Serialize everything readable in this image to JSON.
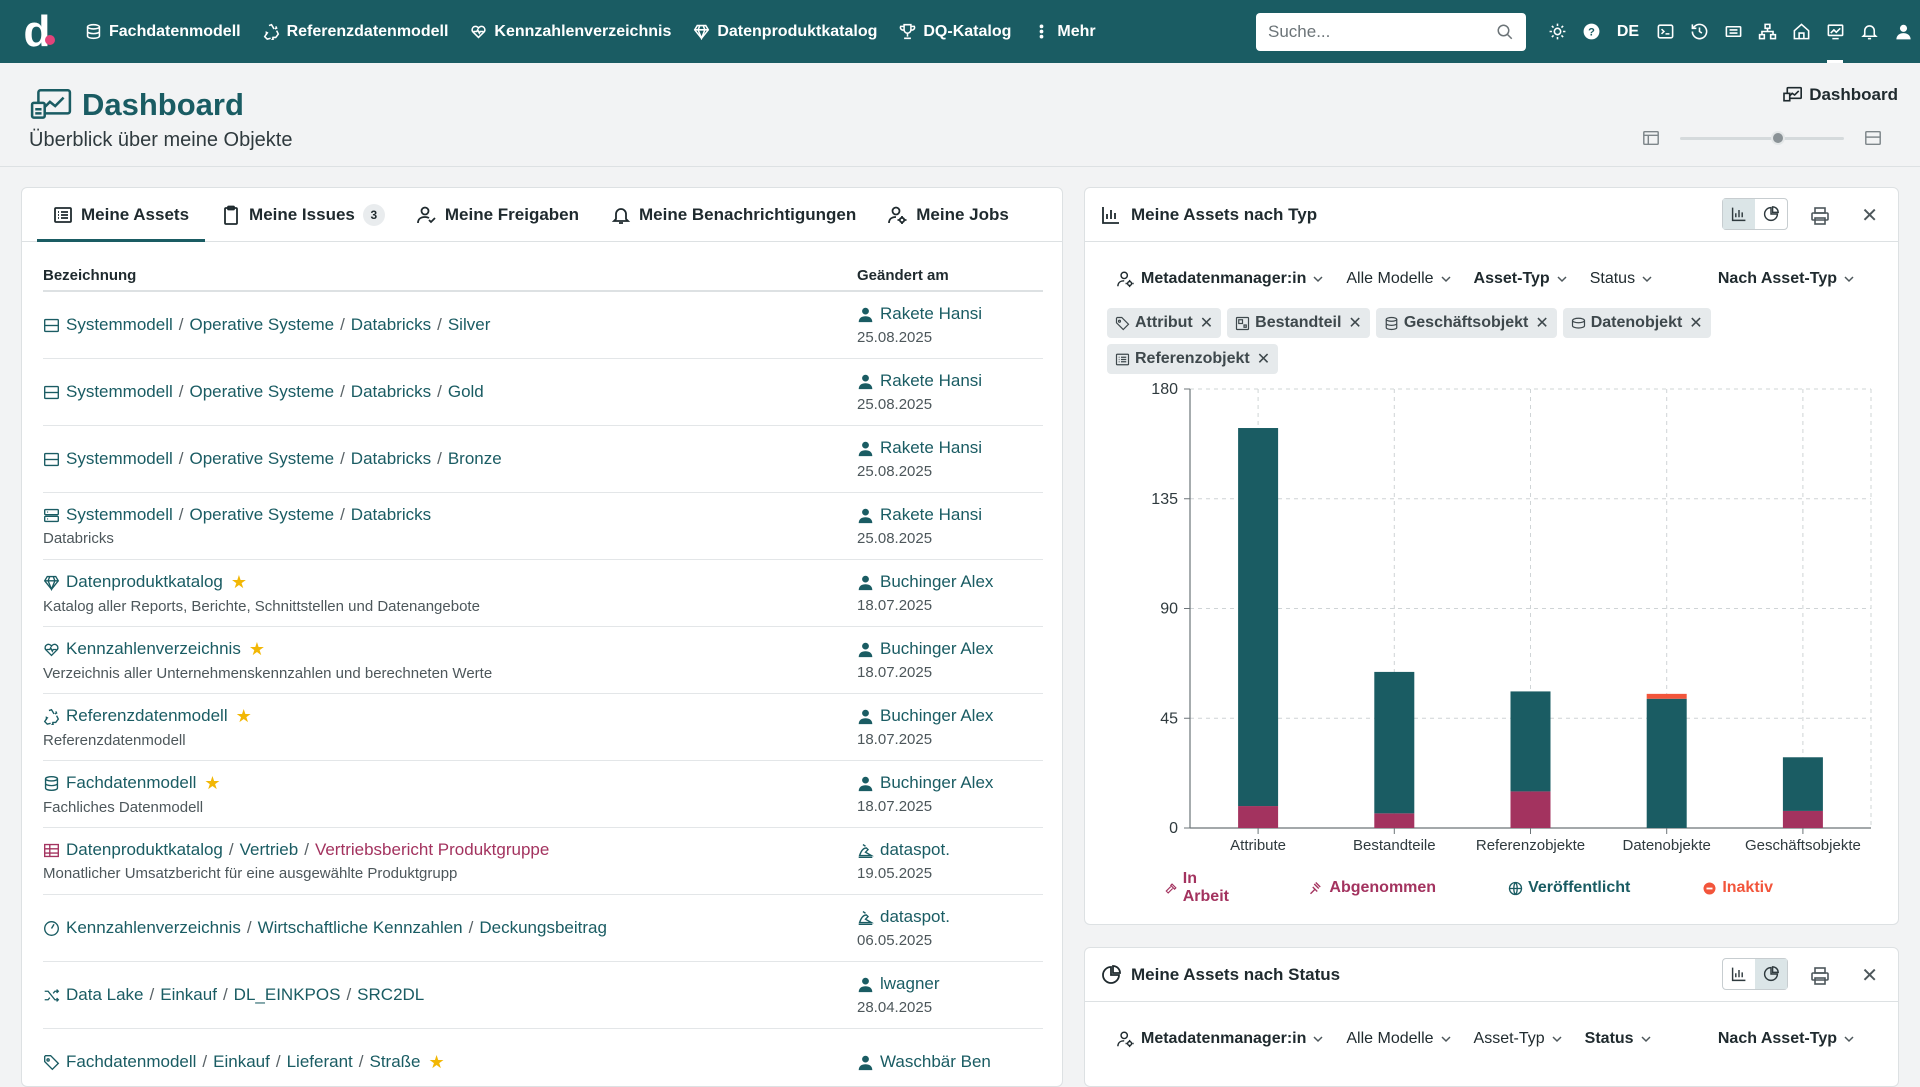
{
  "nav": {
    "logo": "d",
    "items": [
      {
        "label": "Fachdatenmodell",
        "icon": "database-icon"
      },
      {
        "label": "Referenzdatenmodell",
        "icon": "recycle-icon"
      },
      {
        "label": "Kennzahlenverzeichnis",
        "icon": "heart-pulse-icon"
      },
      {
        "label": "Datenproduktkatalog",
        "icon": "diamond-icon"
      },
      {
        "label": "DQ-Katalog",
        "icon": "trophy-icon"
      },
      {
        "label": "Mehr",
        "icon": "more-vertical-icon"
      }
    ],
    "search_placeholder": "Suche...",
    "language": "DE"
  },
  "header": {
    "title": "Dashboard",
    "subtitle": "Überblick über meine Objekte",
    "crumb": "Dashboard",
    "layout_slider_fraction": 0.6
  },
  "tabs": [
    {
      "label": "Meine Assets",
      "icon": "list-icon",
      "active": true
    },
    {
      "label": "Meine Issues",
      "icon": "clipboard-icon",
      "badge": "3"
    },
    {
      "label": "Meine Freigaben",
      "icon": "user-check-icon"
    },
    {
      "label": "Meine Benachrichtigungen",
      "icon": "bell-icon"
    },
    {
      "label": "Meine Jobs",
      "icon": "user-cog-icon"
    }
  ],
  "table": {
    "col_name": "Bezeichnung",
    "col_changed": "Geändert am",
    "rows": [
      {
        "icon": "table-icon",
        "parts": [
          "Systemmodell",
          "Operative Systeme",
          "Databricks",
          "Silver"
        ],
        "desc": "",
        "star": false,
        "user": "Rakete Hansi",
        "date": "25.08.2025",
        "user_icon": "user-icon"
      },
      {
        "icon": "table-icon",
        "parts": [
          "Systemmodell",
          "Operative Systeme",
          "Databricks",
          "Gold"
        ],
        "desc": "",
        "star": false,
        "user": "Rakete Hansi",
        "date": "25.08.2025",
        "user_icon": "user-icon"
      },
      {
        "icon": "table-icon",
        "parts": [
          "Systemmodell",
          "Operative Systeme",
          "Databricks",
          "Bronze"
        ],
        "desc": "",
        "star": false,
        "user": "Rakete Hansi",
        "date": "25.08.2025",
        "user_icon": "user-icon"
      },
      {
        "icon": "server-icon",
        "parts": [
          "Systemmodell",
          "Operative Systeme",
          "Databricks"
        ],
        "desc": "Databricks",
        "star": false,
        "user": "Rakete Hansi",
        "date": "25.08.2025",
        "user_icon": "user-icon"
      },
      {
        "icon": "diamond-icon",
        "parts": [
          "Datenproduktkatalog"
        ],
        "desc": "Katalog aller Reports, Berichte, Schnittstellen und Datenangebote",
        "star": true,
        "user": "Buchinger Alex",
        "date": "18.07.2025",
        "user_icon": "user-icon"
      },
      {
        "icon": "heart-pulse-icon",
        "parts": [
          "Kennzahlenverzeichnis"
        ],
        "desc": "Verzeichnis aller Unternehmenskennzahlen und berechneten Werte",
        "star": true,
        "user": "Buchinger Alex",
        "date": "18.07.2025",
        "user_icon": "user-icon"
      },
      {
        "icon": "recycle-icon",
        "parts": [
          "Referenzdatenmodell"
        ],
        "desc": "Referenzdatenmodell",
        "star": true,
        "user": "Buchinger Alex",
        "date": "18.07.2025",
        "user_icon": "user-icon"
      },
      {
        "icon": "database-icon",
        "parts": [
          "Fachdatenmodell"
        ],
        "desc": "Fachliches Datenmodell",
        "star": true,
        "user": "Buchinger Alex",
        "date": "18.07.2025",
        "user_icon": "user-icon"
      },
      {
        "icon": "grid-icon",
        "parts": [
          "Datenproduktkatalog",
          "Vertrieb",
          "Vertriebsbericht Produktgruppe"
        ],
        "desc": "Monatlicher Umsatzbericht für eine ausgewählte Produktgrupp",
        "star": false,
        "user": "dataspot.",
        "date": "19.05.2025",
        "user_icon": "robot-icon",
        "last_highlight": true,
        "red_icon": true
      },
      {
        "icon": "gauge-icon",
        "parts": [
          "Kennzahlenverzeichnis",
          "Wirtschaftliche Kennzahlen",
          "Deckungsbeitrag"
        ],
        "desc": "",
        "star": false,
        "user": "dataspot.",
        "date": "06.05.2025",
        "user_icon": "robot-icon"
      },
      {
        "icon": "shuffle-icon",
        "parts": [
          "Data Lake",
          "Einkauf",
          "DL_EINKPOS",
          "SRC2DL"
        ],
        "desc": "",
        "star": false,
        "user": "lwagner",
        "date": "28.04.2025",
        "user_icon": "user-icon"
      },
      {
        "icon": "tag-icon",
        "parts": [
          "Fachdatenmodell",
          "Einkauf",
          "Lieferant",
          "Straße"
        ],
        "desc": "",
        "star": true,
        "user": "Waschbär Ben",
        "date": "",
        "user_icon": "user-icon"
      }
    ]
  },
  "chart_card": {
    "title": "Meine Assets nach Typ",
    "filters": [
      {
        "label": "Metadatenmanager:in",
        "bold": true,
        "icon": "user-icon"
      },
      {
        "label": "Alle Modelle",
        "bold": false
      },
      {
        "label": "Asset-Typ",
        "bold": true
      },
      {
        "label": "Status",
        "bold": false
      },
      {
        "label": "Nach Asset-Typ",
        "bold": true
      }
    ],
    "chips": [
      {
        "label": "Attribut",
        "icon": "tag-icon"
      },
      {
        "label": "Bestandteil",
        "icon": "component-icon"
      },
      {
        "label": "Geschäftsobjekt",
        "icon": "database-icon"
      },
      {
        "label": "Datenobjekt",
        "icon": "stack-icon"
      },
      {
        "label": "Referenzobjekt",
        "icon": "list-icon"
      }
    ],
    "legend": [
      {
        "label": "In Arbeit",
        "color": "#a3335f",
        "icon": "hammer-icon"
      },
      {
        "label": "Abgenommen",
        "color": "#a3335f",
        "icon": "gavel-icon"
      },
      {
        "label": "Veröffentlicht",
        "color": "#1a5c63",
        "icon": "globe-icon"
      },
      {
        "label": "Inaktiv",
        "color": "#f2553b",
        "icon": "minus-circle-icon"
      }
    ]
  },
  "chart_data": {
    "type": "bar",
    "stacked": true,
    "categories": [
      "Attribute",
      "Bestandteile",
      "Referenzobjekte",
      "Datenobjekte",
      "Geschäftsobjekte"
    ],
    "series": [
      {
        "name": "In Arbeit",
        "color": "#a3335f",
        "values": [
          9,
          6,
          15,
          0,
          7
        ]
      },
      {
        "name": "Veröffentlicht",
        "color": "#1a5c63",
        "values": [
          155,
          58,
          41,
          53,
          22
        ]
      },
      {
        "name": "Inaktiv",
        "color": "#f2553b",
        "values": [
          0,
          0,
          0,
          2,
          0
        ]
      }
    ],
    "yticks": [
      0,
      45,
      90,
      135,
      180
    ],
    "ylim": [
      0,
      180
    ],
    "grid": true
  },
  "status_card": {
    "title": "Meine Assets nach Status",
    "filters": [
      {
        "label": "Metadatenmanager:in",
        "bold": true
      },
      {
        "label": "Alle Modelle",
        "bold": false
      },
      {
        "label": "Asset-Typ",
        "bold": false
      },
      {
        "label": "Status",
        "bold": true
      },
      {
        "label": "Nach Asset-Typ",
        "bold": true
      }
    ]
  }
}
